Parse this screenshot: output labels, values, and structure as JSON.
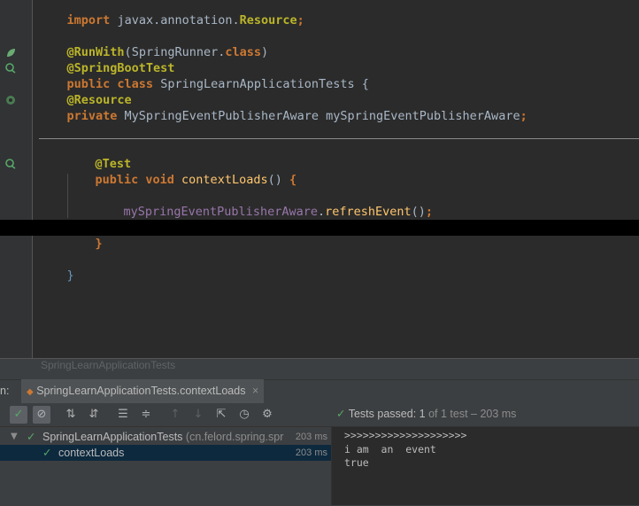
{
  "editor": {
    "line_import": {
      "kw": "import",
      "pkg": "javax.annotation.",
      "cls": "Resource",
      "end": ";"
    },
    "line_runwith": {
      "ann": "@RunWith",
      "open": "(",
      "cls": "SpringRunner",
      "dot": ".",
      "kw": "class",
      "close": ")"
    },
    "line_springboottest": "@SpringBootTest",
    "line_class": {
      "kw": "public class",
      "name": " SpringLearnApplicationTests ",
      "brace": "{"
    },
    "line_resource": "@Resource",
    "line_field": {
      "kw": "private",
      "type": " MySpringEventPublisherAware ",
      "name": "mySpringEventPublisherAware",
      "end": ";"
    },
    "line_test": "@Test",
    "line_method": {
      "kw": "public void",
      "name": " contextLoads",
      "paren": "()",
      "brace": " {"
    },
    "line_call": {
      "obj": "mySpringEventPublisherAware",
      "dot": ".",
      "method": "refreshEvent",
      "paren": "()",
      "end": ";"
    },
    "line_close_method": "}",
    "line_close_class": "}"
  },
  "tool_window": {
    "title": "SpringLearnApplicationTests",
    "tab_prefix": "n:",
    "tab_label": "SpringLearnApplicationTests.contextLoads",
    "tab_close": "×",
    "status_prefix": "Tests passed: ",
    "status_count": "1",
    "status_of": " of 1 test",
    "status_time": " – 203 ms",
    "tree": [
      {
        "label": "SpringLearnApplicationTests",
        "detail": " (cn.felord.spring.spr",
        "time": "203 ms"
      },
      {
        "label": "contextLoads",
        "time": "203 ms"
      }
    ],
    "console": [
      ">>>>>>>>>>>>>>>>>>>>",
      "i am  an  event",
      "true"
    ]
  },
  "colors": {
    "accent_green": "#59a869",
    "selection": "#0d293e",
    "keyword": "#cc7832",
    "annotation": "#bbb529"
  },
  "icons": [
    "spring-bean-icon",
    "run-test-icon",
    "autowired-icon",
    "bookmark-icon",
    "pass-check-icon",
    "cancel-icon",
    "sort-alpha-icon",
    "sort-duration-icon",
    "expand-all-icon",
    "collapse-all-icon",
    "up-arrow-icon",
    "down-arrow-icon",
    "export-icon",
    "history-icon",
    "settings-icon"
  ]
}
